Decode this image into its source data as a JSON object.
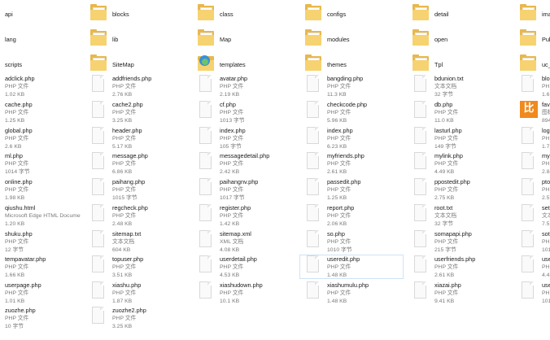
{
  "explorer": {
    "columns": [
      [
        {
          "name": "api",
          "kind": "folder"
        },
        {
          "name": "lang",
          "kind": "folder"
        },
        {
          "name": "scripts",
          "kind": "folder"
        },
        {
          "name": "adclick.php",
          "type": "PHP 文件",
          "size": "1.02 KB",
          "kind": "file"
        },
        {
          "name": "cache.php",
          "type": "PHP 文件",
          "size": "1.25 KB",
          "kind": "file"
        },
        {
          "name": "global.php",
          "type": "PHP 文件",
          "size": "2.6 KB",
          "kind": "file"
        },
        {
          "name": "ml.php",
          "type": "PHP 文件",
          "size": "1014 字节",
          "kind": "file"
        },
        {
          "name": "online.php",
          "type": "PHP 文件",
          "size": "1.98 KB",
          "kind": "file"
        },
        {
          "name": "qiushu.html",
          "type": "Microsoft Edge HTML Docume...",
          "size": "1.20 KB",
          "kind": "html"
        },
        {
          "name": "shuku.php",
          "type": "PHP 文件",
          "size": "12 字节",
          "kind": "file"
        },
        {
          "name": "tempavatar.php",
          "type": "PHP 文件",
          "size": "1.66 KB",
          "kind": "file"
        },
        {
          "name": "userpage.php",
          "type": "PHP 文件",
          "size": "1.01 KB",
          "kind": "file"
        },
        {
          "name": "zuozhe.php",
          "type": "PHP 文件",
          "size": "10 字节",
          "kind": "file"
        }
      ],
      [
        {
          "name": "blocks",
          "kind": "folder"
        },
        {
          "name": "lib",
          "kind": "folder"
        },
        {
          "name": "SiteMap",
          "kind": "folder"
        },
        {
          "name": "addfriends.php",
          "type": "PHP 文件",
          "size": "2.76 KB",
          "kind": "file"
        },
        {
          "name": "cache2.php",
          "type": "PHP 文件",
          "size": "3.25 KB",
          "kind": "file"
        },
        {
          "name": "header.php",
          "type": "PHP 文件",
          "size": "5.17 KB",
          "kind": "file"
        },
        {
          "name": "message.php",
          "type": "PHP 文件",
          "size": "6.86 KB",
          "kind": "file"
        },
        {
          "name": "paihang.php",
          "type": "PHP 文件",
          "size": "1015 字节",
          "kind": "file"
        },
        {
          "name": "regcheck.php",
          "type": "PHP 文件",
          "size": "2.48 KB",
          "kind": "file"
        },
        {
          "name": "sitemap.txt",
          "type": "文本文档",
          "size": "604 KB",
          "kind": "file"
        },
        {
          "name": "topuser.php",
          "type": "PHP 文件",
          "size": "3.51 KB",
          "kind": "file"
        },
        {
          "name": "xiashu.php",
          "type": "PHP 文件",
          "size": "1.87 KB",
          "kind": "file"
        },
        {
          "name": "zuozhe2.php",
          "type": "PHP 文件",
          "size": "3.25 KB",
          "kind": "file"
        }
      ],
      [
        {
          "name": "class",
          "kind": "folder"
        },
        {
          "name": "Map",
          "kind": "folder"
        },
        {
          "name": "templates",
          "kind": "template"
        },
        {
          "name": "avatar.php",
          "type": "PHP 文件",
          "size": "2.19 KB",
          "kind": "file"
        },
        {
          "name": "cf.php",
          "type": "PHP 文件",
          "size": "1013 字节",
          "kind": "file"
        },
        {
          "name": "index.php",
          "type": "PHP 文件",
          "size": "105 字节",
          "kind": "file"
        },
        {
          "name": "messagedetail.php",
          "type": "PHP 文件",
          "size": "2.42 KB",
          "kind": "file"
        },
        {
          "name": "paihangnv.php",
          "type": "PHP 文件",
          "size": "1017 字节",
          "kind": "file"
        },
        {
          "name": "register.php",
          "type": "PHP 文件",
          "size": "1.42 KB",
          "kind": "file"
        },
        {
          "name": "sitemap.xml",
          "type": "XML 文档",
          "size": "4.08 KB",
          "kind": "file"
        },
        {
          "name": "userdetail.php",
          "type": "PHP 文件",
          "size": "4.53 KB",
          "kind": "file"
        },
        {
          "name": "xiashudown.php",
          "type": "PHP 文件",
          "size": "10.1 KB",
          "kind": "file"
        }
      ],
      [
        {
          "name": "configs",
          "kind": "folder"
        },
        {
          "name": "modules",
          "kind": "folder"
        },
        {
          "name": "themes",
          "kind": "folder"
        },
        {
          "name": "bangding.php",
          "type": "PHP 文件",
          "size": "11.3 KB",
          "kind": "file"
        },
        {
          "name": "checkcode.php",
          "type": "PHP 文件",
          "size": "5.96 KB",
          "kind": "file"
        },
        {
          "name": "index.php",
          "type": "PHP 文件",
          "size": "6.23 KB",
          "kind": "file"
        },
        {
          "name": "myfriends.php",
          "type": "PHP 文件",
          "size": "2.61 KB",
          "kind": "file"
        },
        {
          "name": "passedit.php",
          "type": "PHP 文件",
          "size": "1.25 KB",
          "kind": "file"
        },
        {
          "name": "report.php",
          "type": "PHP 文件",
          "size": "2.06 KB",
          "kind": "file"
        },
        {
          "name": "so.php",
          "type": "PHP 文件",
          "size": "1010 字节",
          "kind": "file"
        },
        {
          "name": "useredit.php",
          "type": "PHP 文件",
          "size": "1.48 KB",
          "kind": "file",
          "selected": true
        },
        {
          "name": "xiashumulu.php",
          "type": "PHP 文件",
          "size": "1.48 KB",
          "kind": "file"
        }
      ],
      [
        {
          "name": "detail",
          "kind": "folder"
        },
        {
          "name": "open",
          "kind": "folder"
        },
        {
          "name": "Tpl",
          "kind": "folder"
        },
        {
          "name": "bdunion.txt",
          "type": "文本文档",
          "size": "32 字节",
          "kind": "file"
        },
        {
          "name": "db.php",
          "type": "PHP 文件",
          "size": "11.0 KB",
          "kind": "file"
        },
        {
          "name": "lasturl.php",
          "type": "PHP 文件",
          "size": "149 字节",
          "kind": "file"
        },
        {
          "name": "mylink.php",
          "type": "PHP 文件",
          "size": "4.49 KB",
          "kind": "file"
        },
        {
          "name": "ppostedit.php",
          "type": "PHP 文件",
          "size": "2.75 KB",
          "kind": "file"
        },
        {
          "name": "root.txt",
          "type": "文本文档",
          "size": "32 字节",
          "kind": "file"
        },
        {
          "name": "somapapi.php",
          "type": "PHP 文件",
          "size": "215 字节",
          "kind": "file"
        },
        {
          "name": "userfriends.php",
          "type": "PHP 文件",
          "size": "2.61 KB",
          "kind": "file"
        },
        {
          "name": "xiazai.php",
          "type": "PHP 文件",
          "size": "9.41 KB",
          "kind": "file"
        }
      ],
      [
        {
          "name": "image",
          "kind": "folder"
        },
        {
          "name": "Public",
          "kind": "folder"
        },
        {
          "name": "uc_cli",
          "kind": "folder"
        },
        {
          "name": "blocks",
          "type": "PHP 文",
          "size": "1.61 K",
          "kind": "file"
        },
        {
          "name": "favico",
          "type": "图标",
          "size": "894 字",
          "kind": "favicon"
        },
        {
          "name": "login.",
          "type": "PHP 文",
          "size": "1.71 K",
          "kind": "file"
        },
        {
          "name": "mysql",
          "type": "PHP 文",
          "size": "2.84 K",
          "kind": "file"
        },
        {
          "name": "ptopic",
          "type": "PHP 文",
          "size": "2.57 K",
          "kind": "file"
        },
        {
          "name": "setava",
          "type": "文本文",
          "size": "7.51 K",
          "kind": "file"
        },
        {
          "name": "sotop",
          "type": "PHP 文",
          "size": "1016",
          "kind": "file"
        },
        {
          "name": "userin",
          "type": "PHP 文",
          "size": "4.43 K",
          "kind": "file"
        },
        {
          "name": "usernh",
          "type": "PHP 文",
          "size": "1016",
          "kind": "file"
        }
      ]
    ],
    "favicon_glyph": "比",
    "colors": {
      "folder": "#e8b84c",
      "accent": "#2f8ad4",
      "selection_border": "#cfe3f7",
      "favicon": "#f08a1c"
    }
  }
}
